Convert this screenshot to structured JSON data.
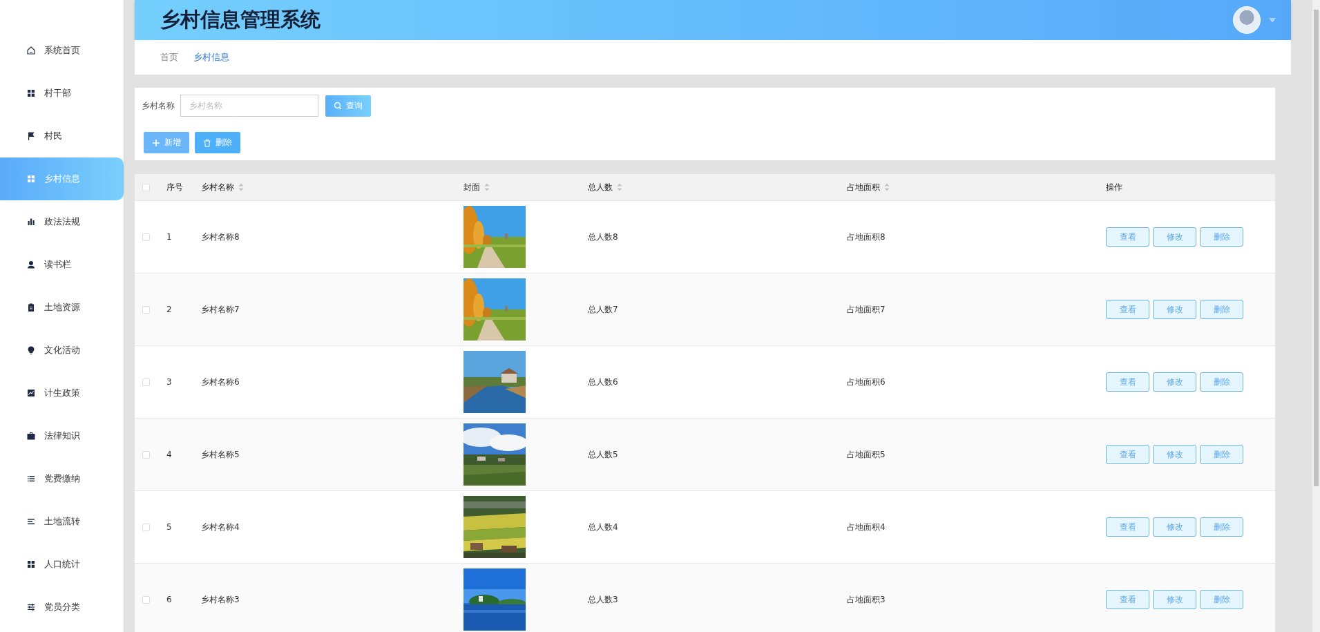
{
  "sidebar": {
    "items": [
      {
        "label": "系统首页",
        "selected": false
      },
      {
        "label": "村干部",
        "selected": false
      },
      {
        "label": "村民",
        "selected": false
      },
      {
        "label": "乡村信息",
        "selected": true
      },
      {
        "label": "政法法规",
        "selected": false
      },
      {
        "label": "读书栏",
        "selected": false
      },
      {
        "label": "土地资源",
        "selected": false
      },
      {
        "label": "文化活动",
        "selected": false
      },
      {
        "label": "计生政策",
        "selected": false
      },
      {
        "label": "法律知识",
        "selected": false
      },
      {
        "label": "党费缴纳",
        "selected": false
      },
      {
        "label": "土地流转",
        "selected": false
      },
      {
        "label": "人口统计",
        "selected": false
      },
      {
        "label": "党员分类",
        "selected": false
      }
    ]
  },
  "header": {
    "title": "乡村信息管理系统"
  },
  "breadcrumb": [
    {
      "label": "首页",
      "selected": false
    },
    {
      "label": "乡村信息",
      "selected": true
    }
  ],
  "search": {
    "label": "乡村名称",
    "placeholder": "乡村名称",
    "button": "查询"
  },
  "actions": [
    {
      "kind": "add",
      "label": "新增"
    },
    {
      "kind": "delete",
      "label": "删除"
    }
  ],
  "table": {
    "select_all": {
      "checked": false
    },
    "columns": [
      {
        "label": "序号",
        "sortable": false
      },
      {
        "label": "乡村名称",
        "sortable": true
      },
      {
        "label": "封面",
        "sortable": true
      },
      {
        "label": "总人数",
        "sortable": true
      },
      {
        "label": "占地面积",
        "sortable": true
      },
      {
        "label": "操作",
        "sortable": false
      }
    ],
    "rows": [
      {
        "checked": false,
        "index": "1",
        "name": "乡村名称8",
        "population": "总人数8",
        "area": "占地面积8",
        "actions": [
          "查看",
          "修改",
          "删除"
        ]
      },
      {
        "checked": false,
        "index": "2",
        "name": "乡村名称7",
        "population": "总人数7",
        "area": "占地面积7",
        "actions": [
          "查看",
          "修改",
          "删除"
        ]
      },
      {
        "checked": false,
        "index": "3",
        "name": "乡村名称6",
        "population": "总人数6",
        "area": "占地面积6",
        "actions": [
          "查看",
          "修改",
          "删除"
        ]
      },
      {
        "checked": false,
        "index": "4",
        "name": "乡村名称5",
        "population": "总人数5",
        "area": "占地面积5",
        "actions": [
          "查看",
          "修改",
          "删除"
        ]
      },
      {
        "checked": false,
        "index": "5",
        "name": "乡村名称4",
        "population": "总人数4",
        "area": "占地面积4",
        "actions": [
          "查看",
          "修改",
          "删除"
        ]
      },
      {
        "checked": false,
        "index": "6",
        "name": "乡村名称3",
        "population": "总人数3",
        "area": "占地面积3",
        "actions": [
          "查看",
          "修改",
          "删除"
        ]
      }
    ]
  }
}
